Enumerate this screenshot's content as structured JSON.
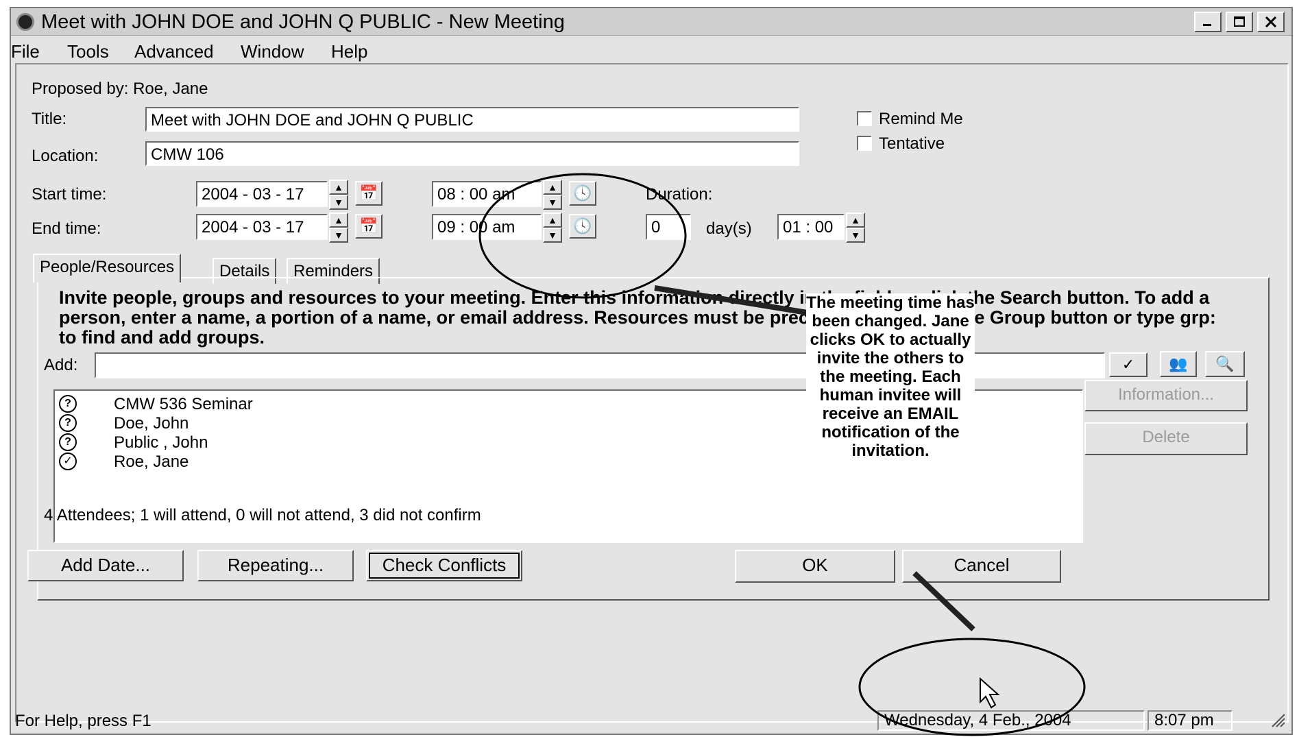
{
  "window": {
    "title": "Meet with JOHN DOE and JOHN Q PUBLIC - New Meeting"
  },
  "menu": [
    "File",
    "Tools",
    "Advanced",
    "Window",
    "Help"
  ],
  "form": {
    "proposed_by": "Proposed by: Roe, Jane",
    "title_label": "Title:",
    "title_value": "Meet with JOHN DOE and JOHN Q PUBLIC",
    "location_label": "Location:",
    "location_value": "CMW 106",
    "remind_me_label": "Remind Me",
    "tentative_label": "Tentative",
    "start_label": "Start time:",
    "start_date": "2004 - 03 - 17",
    "start_time": "08 : 00 am",
    "end_label": "End time:",
    "end_date": "2004 - 03 - 17",
    "end_time": "09 : 00 am",
    "duration_label": "Duration:",
    "duration_days": "0",
    "days_label": "day(s)",
    "duration_time": "01 : 00"
  },
  "tabs": [
    "People/Resources",
    "Details",
    "Reminders"
  ],
  "people_tab": {
    "instructions": "Invite people, groups and resources to your meeting. Enter this information directly in the field or click the Search button. To add a person, enter a name, a portion of a name, or email address. Resources must be preceded by r:. Click the Group button or type grp: to find and add groups.",
    "add_label": "Add:",
    "add_value": "",
    "attendees": [
      {
        "status": "?",
        "name": "CMW 536 Seminar"
      },
      {
        "status": "?",
        "name": "Doe, John"
      },
      {
        "status": "?",
        "name": "Public , John"
      },
      {
        "status": "✓",
        "name": "Roe, Jane"
      }
    ],
    "information_button": "Information...",
    "delete_button": "Delete",
    "summary": "4 Attendees; 1 will attend, 0 will not attend, 3 did not confirm"
  },
  "buttons": {
    "add_date": "Add Date...",
    "repeating": "Repeating...",
    "check_conflicts": "Check Conflicts",
    "ok": "OK",
    "cancel": "Cancel"
  },
  "status": {
    "help": "For Help, press F1",
    "date": "Wednesday, 4 Feb., 2004",
    "time": "8:07 pm"
  },
  "annotation": {
    "text": "The meeting time has been changed. Jane clicks OK to actually invite the others to the meeting. Each human invitee will receive an EMAIL notification of the invitation."
  }
}
